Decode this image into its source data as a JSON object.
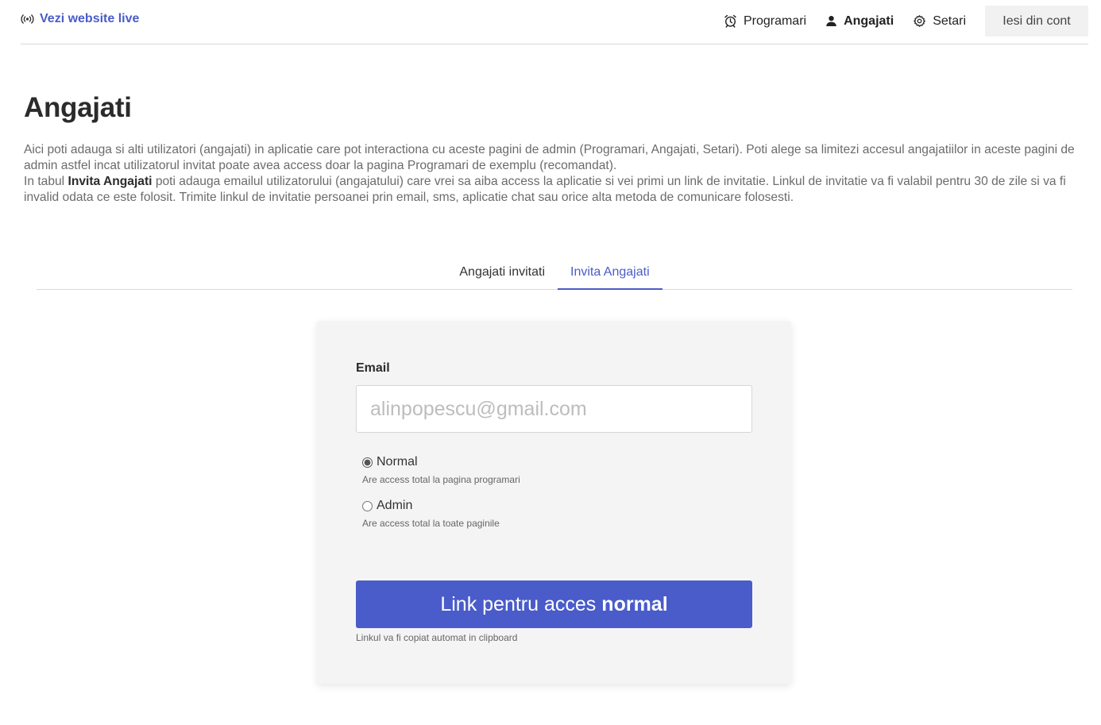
{
  "nav": {
    "live_link": "Vezi website live",
    "items": [
      {
        "label": "Programari",
        "icon": "alarm-clock-icon"
      },
      {
        "label": "Angajati",
        "icon": "user-icon"
      },
      {
        "label": "Setari",
        "icon": "gear-icon"
      }
    ],
    "active_item": "Angajati",
    "logout": "Iesi din cont"
  },
  "page": {
    "title": "Angajati",
    "description_p1": "Aici poti adauga si alti utilizatori (angajati) in aplicatie care pot interactiona cu aceste pagini de admin (Programari, Angajati, Setari). Poti alege sa limitezi accesul angajatiilor in aceste pagini de admin astfel incat utilizatorul invitat poate avea access doar la pagina Programari de exemplu (recomandat).",
    "description_p2_before": "In tabul ",
    "description_p2_bold": "Invita Angajati",
    "description_p2_after": " poti adauga emailul utilizatorului (angajatului) care vrei sa aiba access la aplicatie si vei primi un link de invitatie. Linkul de invitatie va fi valabil pentru 30 de zile si va fi invalid odata ce este folosit. Trimite linkul de invitatie persoanei prin email, sms, aplicatie chat sau orice alta metoda de comunicare folosesti."
  },
  "tabs": [
    {
      "label": "Angajati invitati",
      "active": false
    },
    {
      "label": "Invita Angajati",
      "active": true
    }
  ],
  "form": {
    "email_label": "Email",
    "email_value": "",
    "email_placeholder": "alinpopescu@gmail.com",
    "options": [
      {
        "label": "Normal",
        "help": "Are access total la pagina programari",
        "checked": true
      },
      {
        "label": "Admin",
        "help": "Are access total la toate paginile",
        "checked": false
      }
    ],
    "submit_prefix": "Link pentru acces",
    "submit_mode": "normal",
    "clipboard_note": "Linkul va fi copiat automat in clipboard"
  },
  "colors": {
    "accent": "#4a5cc9",
    "card_bg": "#f4f4f4",
    "logout_bg": "#f1f1f1"
  }
}
